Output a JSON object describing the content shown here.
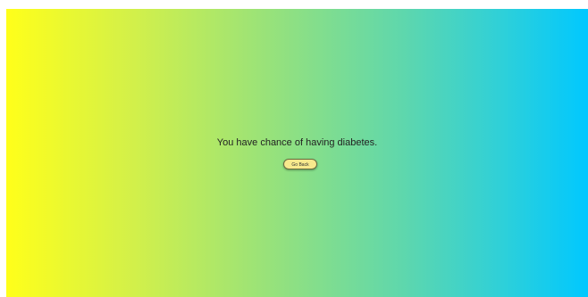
{
  "result": {
    "message": "You have chance of having diabetes."
  },
  "actions": {
    "back_label": "Go Back"
  },
  "colors": {
    "gradient_start": "#ffff1a",
    "gradient_end": "#00c8ff",
    "button_bg": "#f7e98d"
  }
}
